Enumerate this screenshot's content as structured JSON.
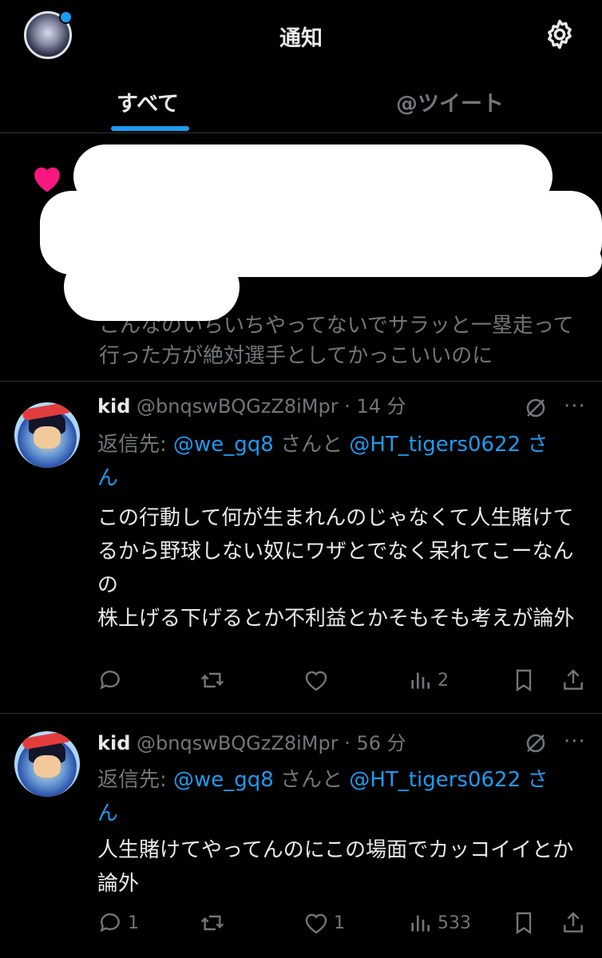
{
  "header": {
    "title": "通知",
    "icons": [
      "profile-avatar",
      "gear-icon"
    ]
  },
  "tabs": [
    {
      "label": "すべて",
      "active": true
    },
    {
      "label": "@ツイート",
      "active": false
    }
  ],
  "like_notification": {
    "icon": "heart-icon",
    "text": "こんなのいちいちやってないでサラッと一塁走って行った方が絶対選手としてかっこいいのに"
  },
  "tweets": [
    {
      "name": "kid",
      "handle": "@bnqswBQGzZ8iMpr",
      "time": "14 分",
      "reply_prefix": "返信先: ",
      "mention1": "@we_gq8",
      "mention_join": " さんと ",
      "mention2": "@HT_tigers0622",
      "mention_suffix": " さ",
      "mention_suffix2": "ん",
      "body": "この行動して何が生まれんのじゃなくて人生賭けてるから野球しない奴にワザとでなく呆れてこーなんの\n株上げる下げるとか不利益とかそもそも考えが論外",
      "counts": {
        "reply": "",
        "retweet": "",
        "like": "",
        "views": "2"
      }
    },
    {
      "name": "kid",
      "handle": "@bnqswBQGzZ8iMpr",
      "time": "56 分",
      "reply_prefix": "返信先: ",
      "mention1": "@we_gq8",
      "mention_join": " さんと ",
      "mention2": "@HT_tigers0622",
      "mention_suffix": " さ",
      "mention_suffix2": "ん",
      "body": "人生賭けてやってんのにこの場面でカッコイイとか論外",
      "counts": {
        "reply": "1",
        "retweet": "",
        "like": "1",
        "views": "533"
      }
    }
  ],
  "colors": {
    "accent": "#1d9bf0",
    "muted": "#71767b",
    "like": "#f91880"
  }
}
